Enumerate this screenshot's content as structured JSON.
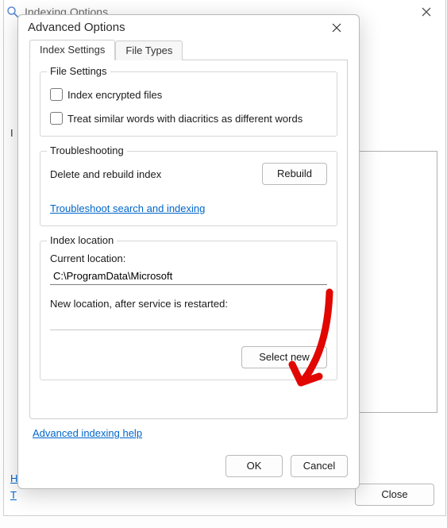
{
  "parent": {
    "title": "Indexing Options",
    "left_letter": "I",
    "links": [
      "H",
      "T"
    ],
    "close_label": "Close"
  },
  "dialog": {
    "title": "Advanced Options"
  },
  "tabs": {
    "index_settings": "Index Settings",
    "file_types": "File Types"
  },
  "file_settings": {
    "legend": "File Settings",
    "encrypted": "Index encrypted files",
    "diacritics": "Treat similar words with diacritics as different words"
  },
  "troubleshooting": {
    "legend": "Troubleshooting",
    "delete_rebuild": "Delete and rebuild index",
    "rebuild_btn": "Rebuild",
    "troubleshoot_link": "Troubleshoot search and indexing"
  },
  "index_location": {
    "legend": "Index location",
    "current_label": "Current location:",
    "current_value": "C:\\ProgramData\\Microsoft",
    "new_label": "New location, after service is restarted:",
    "new_value": "",
    "select_new_btn": "Select new"
  },
  "help_link": "Advanced indexing help",
  "buttons": {
    "ok": "OK",
    "cancel": "Cancel"
  },
  "annotation": {
    "type": "arrow",
    "color": "#e10600",
    "target": "select-new-button"
  }
}
